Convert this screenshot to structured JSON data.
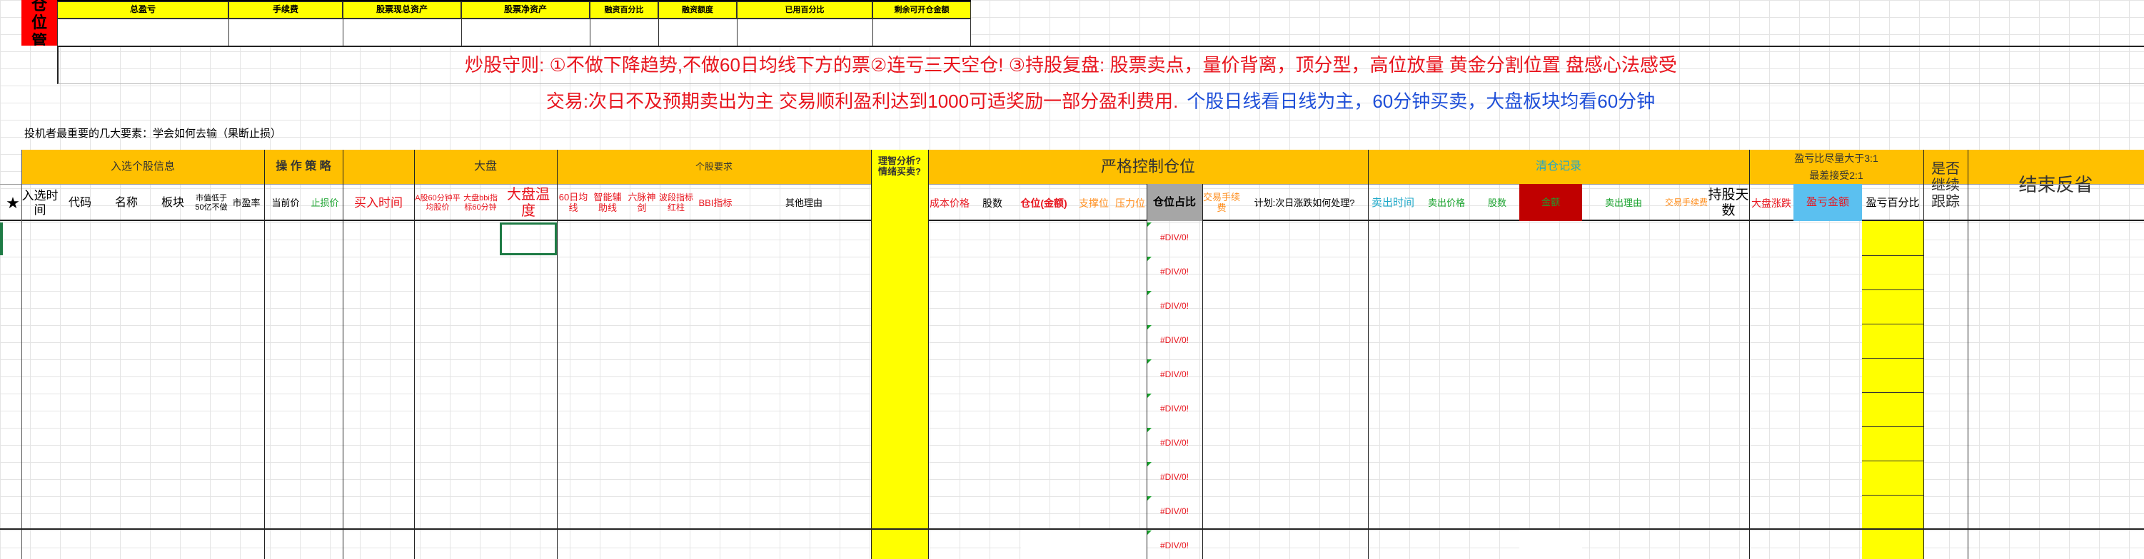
{
  "sheet": {
    "corner_label": "仓位管",
    "summary_headers": [
      "总盈亏",
      "手续费",
      "股票现总资产",
      "股票净资产",
      "融资百分比",
      "融资额度",
      "已用百分比",
      "剩余可开仓金额"
    ],
    "rule_line": "炒股守则: ①不做下降趋势,不做60日均线下方的票②连亏三天空仓! ③持股复盘: 股票卖点，量价背离，顶分型，高位放量 黄金分割位置 盘感心法感受",
    "trade_line_red": "交易:次日不及预期卖出为主  交易顺利盈利达到1000可适奖励一部分盈利费用.",
    "trade_line_blue": "个股日线看日线为主，60分钟买卖，大盘板块均看60分钟",
    "note_line": "投机者最重要的几大要素：学会如何去输（果断止损）"
  },
  "groups": {
    "select_info": "入选个股信息",
    "strategy": "操 作 策 略",
    "market": "大盘",
    "stock_req": "个股要求",
    "sentiment": "理智分析?情绪买卖?",
    "control": "严格控制仓位",
    "clear": "清仓记录",
    "ratio1": "盈亏比尽量大于3:1",
    "ratio2": "最差接受2:1",
    "follow": "是否继续跟踪",
    "review": "结束反省"
  },
  "columns": {
    "star": "★",
    "select_time": "入选时间",
    "code": "代码",
    "name": "名称",
    "sector": "板块",
    "mkt_cap": "市值低于50亿不做",
    "pe": "市盈率",
    "cur_price": "当前价",
    "stop": "止损价",
    "buy_time": "买入时间",
    "a60": "A股60分钟平均股价",
    "bbi": "大盘bbi指标60分钟",
    "temp": "大盘温度",
    "ma60": "60日均线",
    "smart": "智能辅助线",
    "six": "六脉神剑",
    "wave": "波段指标红柱",
    "bbi2": "BBI指标",
    "other": "其他理由",
    "cost": "成本价格",
    "shares": "股数",
    "pos_amt": "仓位(金额)",
    "support": "支撑位",
    "resist": "压力位",
    "pos_pct": "仓位占比",
    "fee_buy": "交易手续费",
    "plan": "计划:次日涨跌如何处理?",
    "sell_time": "卖出时间",
    "sell_price": "卖出价格",
    "sell_shares": "股数",
    "amount": "金额",
    "sell_reason": "卖出理由",
    "fee_sell": "交易手续费",
    "hold_days": "持股天数",
    "mkt_chg": "大盘涨跌",
    "pl_amt": "盈亏金额",
    "pl_pct": "盈亏百分比"
  },
  "error_value": "#DIV/0!",
  "colors": {
    "yellow": "#ffff00",
    "orange": "#ffc000",
    "red_cell": "#c00000",
    "blue_cell": "#5bc0f0",
    "gray_cell": "#a6a6a6",
    "red_text": "#ff0000",
    "blue_text": "#1f4fd8"
  }
}
